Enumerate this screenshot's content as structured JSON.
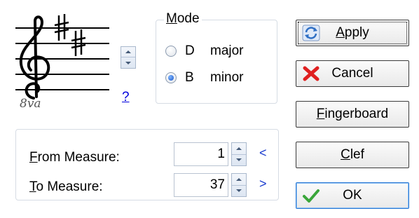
{
  "key_signature": {
    "clef": "treble-8va-bassa",
    "octave_marking": "8va",
    "help_label": "?"
  },
  "mode_group": {
    "legend_prefix": "M",
    "legend_rest": "ode",
    "options": [
      {
        "key": "D",
        "mode": "major",
        "checked": false
      },
      {
        "key": "B",
        "mode": "minor",
        "checked": true
      }
    ]
  },
  "measures": {
    "from_label_u": "F",
    "from_label_rest": "rom Measure:",
    "from_value": "1",
    "from_arrow": "<",
    "to_label_u": "T",
    "to_label_rest": "o Measure:",
    "to_value": "37",
    "to_arrow": ">"
  },
  "buttons": {
    "apply_u": "A",
    "apply_rest": "pply",
    "cancel": "Cancel",
    "fingerboard_u": "F",
    "fingerboard_rest": "ingerboard",
    "clef_u": "C",
    "clef_rest": "lef",
    "ok": "OK"
  },
  "icons": {
    "apply": "refresh-icon",
    "cancel": "red-x-icon",
    "ok": "green-check-icon"
  },
  "colors": {
    "link": "#0000dd",
    "arrow": "#1a3ccf",
    "cancel_x": "#e02020",
    "ok_check": "#3aa63a"
  }
}
